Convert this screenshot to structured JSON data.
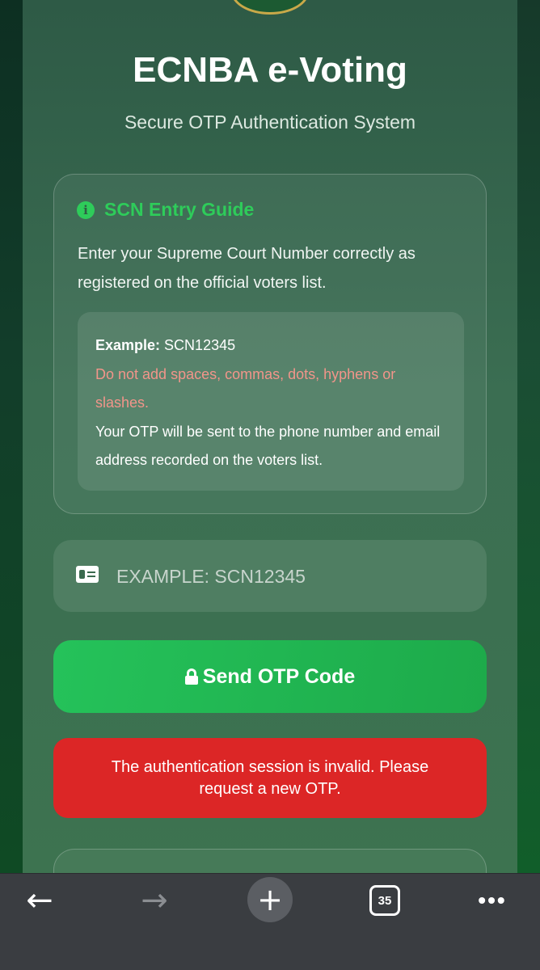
{
  "header": {
    "title": "ECNBA e-Voting",
    "subtitle": "Secure OTP Authentication System"
  },
  "guide": {
    "heading": "SCN Entry Guide",
    "intro": "Enter your Supreme Court Number correctly as registered on the official voters list.",
    "example_label": "Example:",
    "example_value": " SCN12345",
    "warning": "Do not add spaces, commas, dots, hyphens or slashes.",
    "note": "Your OTP will be sent to the phone number and email address recorded on the voters list."
  },
  "scn_field": {
    "value": "",
    "placeholder": "EXAMPLE: SCN12345"
  },
  "send_button": {
    "label": "Send OTP Code"
  },
  "error_message": "The authentication session is invalid. Please request a new OTP.",
  "browser_toolbar": {
    "tab_count": "35"
  },
  "colors": {
    "accent_green": "#22c55e",
    "error_red": "#dc2626",
    "warning_text": "#f2958a"
  }
}
